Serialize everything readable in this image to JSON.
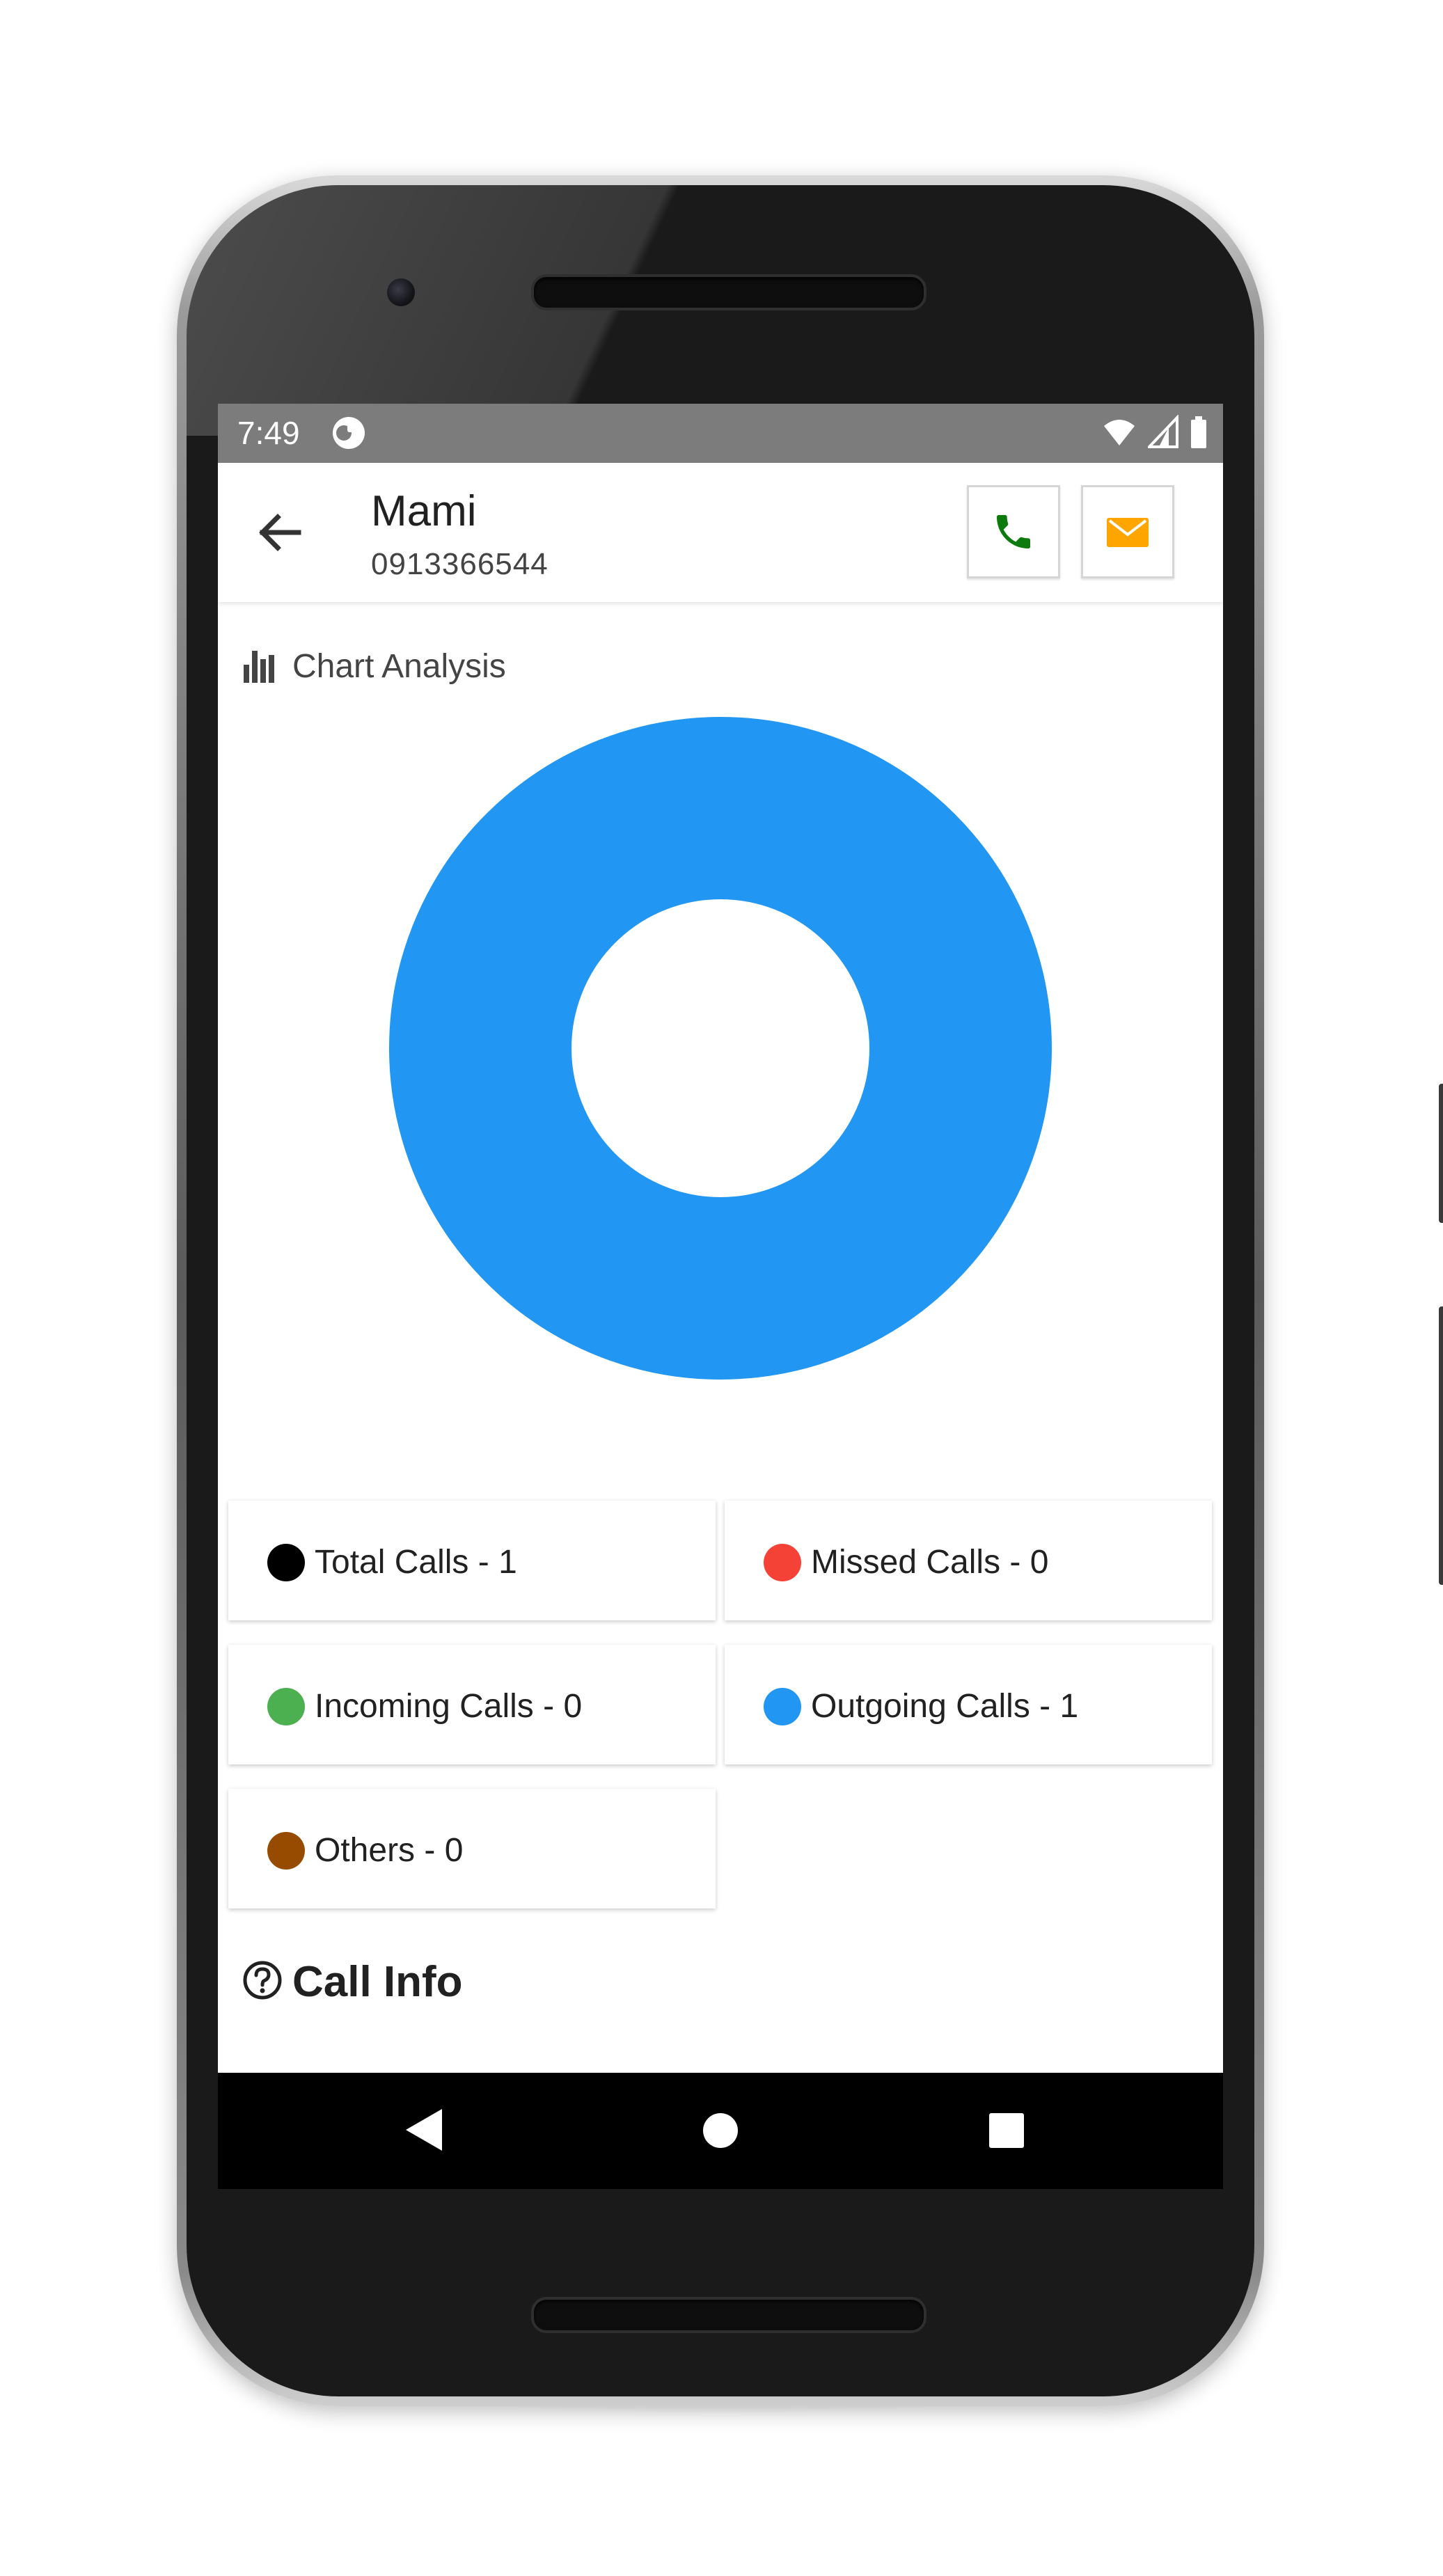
{
  "status_bar": {
    "time": "7:49"
  },
  "app_bar": {
    "contact_name": "Mami",
    "contact_number": "0913366544",
    "icons": {
      "back": "arrow-back-icon",
      "call": "phone-icon",
      "message": "envelope-icon"
    }
  },
  "section": {
    "title": "Chart Analysis",
    "icon": "bar-chart-icon"
  },
  "chart_data": {
    "type": "pie",
    "style": "donut",
    "categories": [
      "Missed Calls",
      "Incoming Calls",
      "Outgoing Calls",
      "Others"
    ],
    "values": [
      0,
      0,
      1,
      0
    ],
    "colors": [
      "#F44336",
      "#4CAF50",
      "#2196F3",
      "#964B00"
    ]
  },
  "legend": [
    {
      "label": "Total Calls - 1",
      "color": "#000000"
    },
    {
      "label": "Missed Calls - 0",
      "color": "#F44336"
    },
    {
      "label": "Incoming Calls - 0",
      "color": "#4CAF50"
    },
    {
      "label": "Outgoing Calls - 1",
      "color": "#2196F3"
    },
    {
      "label": "Others - 0",
      "color": "#964B00"
    }
  ],
  "call_info": {
    "title": "Call Info",
    "icon": "help-circle-icon"
  },
  "nav_bar": {
    "icons": [
      "nav-back-icon",
      "nav-home-icon",
      "nav-recents-icon"
    ]
  },
  "colors": {
    "accent_blue": "#2196F3",
    "call_green": "#0C7A0C",
    "mail_orange": "#FFA500",
    "status_bar_gray": "#7C7C7C"
  }
}
